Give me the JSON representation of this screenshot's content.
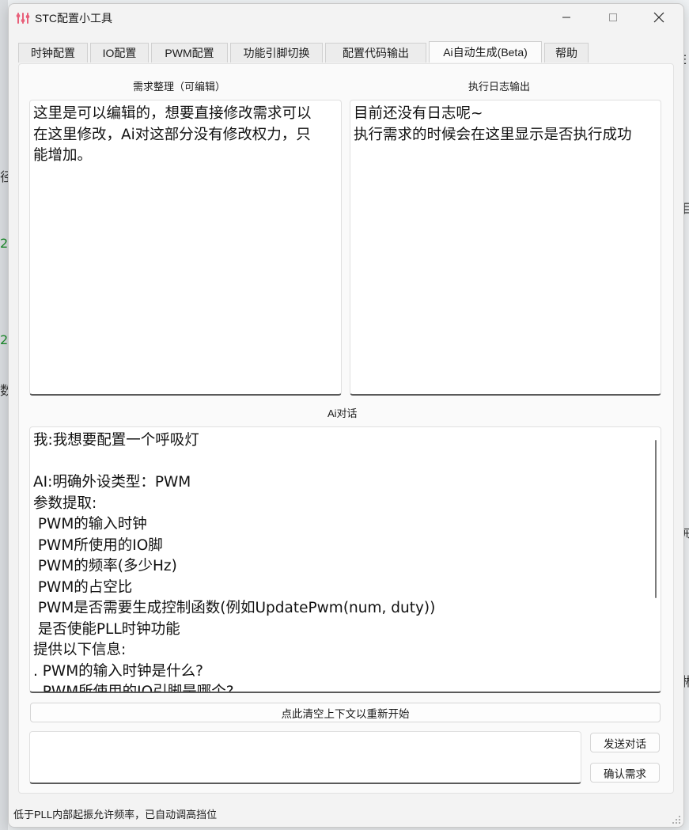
{
  "window": {
    "title": "STC配置小工具"
  },
  "tabs": [
    {
      "label": "时钟配置"
    },
    {
      "label": "IO配置"
    },
    {
      "label": "PWM配置"
    },
    {
      "label": "功能引脚切换"
    },
    {
      "label": "配置代码输出"
    },
    {
      "label": "Ai自动生成(Beta)"
    },
    {
      "label": "帮助"
    }
  ],
  "requirements": {
    "label": "需求整理（可编辑）",
    "lines": [
      "这里是可以编辑的，想要直接修改需求可以",
      "在这里修改，Ai对这部分没有修改权力，只",
      "能增加。"
    ]
  },
  "log": {
    "label": "执行日志输出",
    "lines": [
      "目前还没有日志呢~",
      "执行需求的时候会在这里显示是否执行成功"
    ]
  },
  "chat": {
    "label": "Ai对话",
    "lines": [
      "我:我想要配置一个呼吸灯",
      "",
      "AI:明确外设类型：PWM",
      "参数提取:",
      " PWM的输入时钟",
      " PWM所使用的IO脚",
      " PWM的频率(多少Hz)",
      " PWM的占空比",
      " PWM是否需要生成控制函数(例如UpdatePwm(num, duty))",
      " 是否使能PLL时钟功能",
      "提供以下信息:",
      ". PWM的输入时钟是什么?",
      ". PWM所使用的IO引脚是哪个?"
    ]
  },
  "buttons": {
    "reset": "点此清空上下文以重新开始",
    "send": "发送对话",
    "confirm": "确认需求"
  },
  "input": {
    "value": ""
  },
  "status": {
    "text": "低于PLL内部起振允许频率，已自动调高挡位"
  }
}
